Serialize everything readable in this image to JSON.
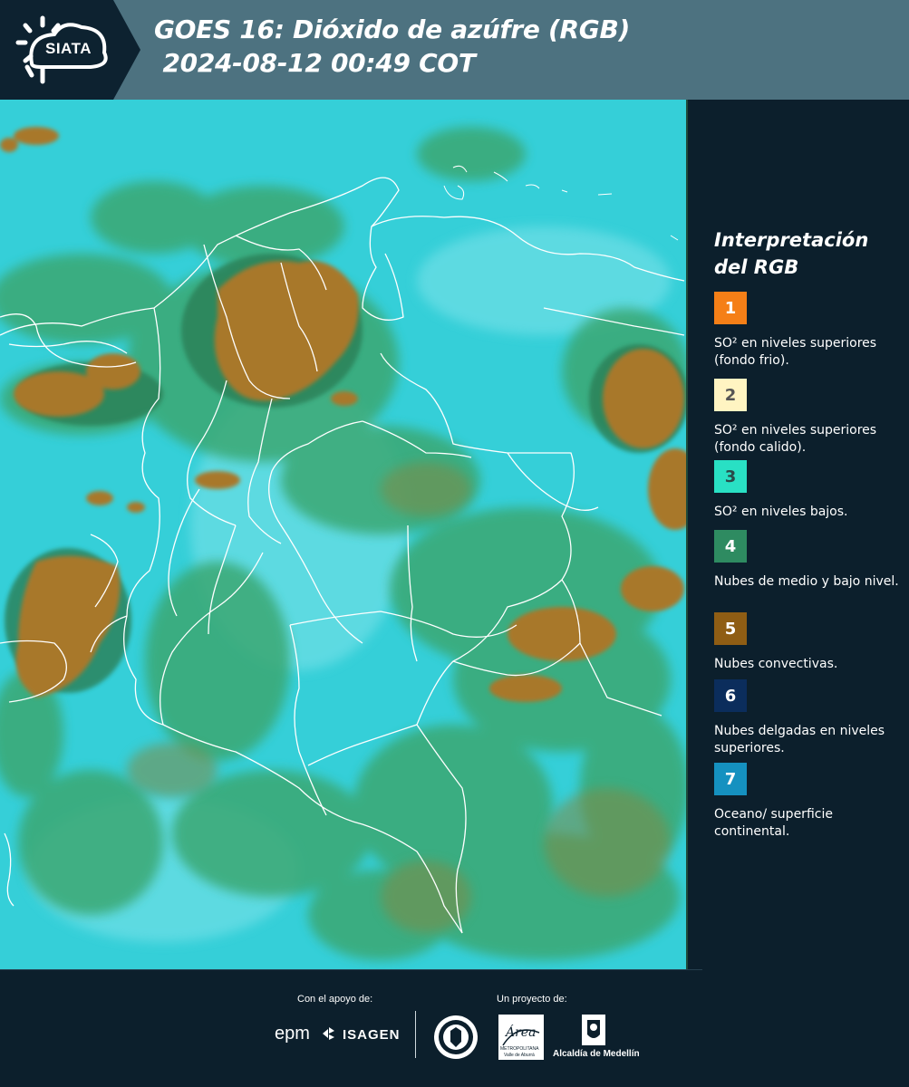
{
  "header": {
    "logo_text": "SIATA",
    "title_line1": "GOES 16: Dióxido de azúfre (RGB)",
    "title_line2": " 2024-08-12 00:49 COT"
  },
  "map": {
    "type": "satellite RGB composite",
    "colors": {
      "ocean_surface": "#35cfd8",
      "low_mid_cloud": "#3aa873",
      "convective_cloud": "#a8782c",
      "borders": "#ffffff"
    }
  },
  "legend": {
    "title_line1": "Interpretación",
    "title_line2": "del RGB",
    "items": [
      {
        "number": "1",
        "color": "#f57f17",
        "label": "SO² en niveles superiores (fondo frio)."
      },
      {
        "number": "2",
        "color": "#fff4c2",
        "label": "SO² en niveles superiores (fondo calido)."
      },
      {
        "number": "3",
        "color": "#29e0c4",
        "label": "SO² en niveles bajos."
      },
      {
        "number": "4",
        "color": "#2e8b61",
        "label": "Nubes de medio y bajo nivel."
      },
      {
        "number": "5",
        "color": "#8f5d14",
        "label": "Nubes convectivas."
      },
      {
        "number": "6",
        "color": "#0b2d5c",
        "label": "Nubes delgadas en niveles superiores."
      },
      {
        "number": "7",
        "color": "#1591c0",
        "label": "Oceano/ superficie continental."
      }
    ]
  },
  "footer": {
    "support_label": "Con el apoyo de:",
    "project_label": "Un proyecto de:",
    "sponsor_epm": "epm",
    "sponsor_isagen": "ISAGEN",
    "area_logo_text": "Área",
    "area_sub1": "METROPOLITANA",
    "area_sub2": "Valle de Aburrá",
    "alcaldia": "Alcaldía de Medellín"
  }
}
